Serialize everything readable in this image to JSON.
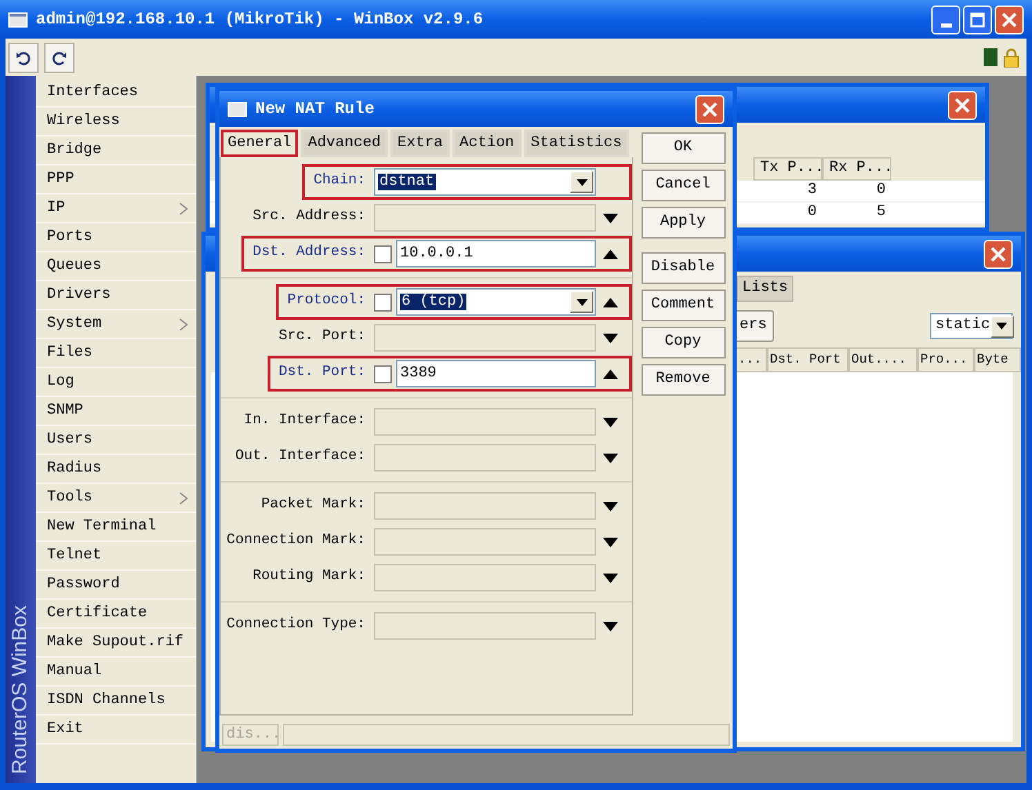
{
  "window": {
    "title": "admin@192.168.10.1 (MikroTik) - WinBox v2.9.6"
  },
  "sidebar": {
    "brand": "RouterOS WinBox",
    "items": [
      {
        "label": "Interfaces",
        "submenu": false
      },
      {
        "label": "Wireless",
        "submenu": false
      },
      {
        "label": "Bridge",
        "submenu": false
      },
      {
        "label": "PPP",
        "submenu": false
      },
      {
        "label": "IP",
        "submenu": true
      },
      {
        "label": "Ports",
        "submenu": false
      },
      {
        "label": "Queues",
        "submenu": false
      },
      {
        "label": "Drivers",
        "submenu": false
      },
      {
        "label": "System",
        "submenu": true
      },
      {
        "label": "Files",
        "submenu": false
      },
      {
        "label": "Log",
        "submenu": false
      },
      {
        "label": "SNMP",
        "submenu": false
      },
      {
        "label": "Users",
        "submenu": false
      },
      {
        "label": "Radius",
        "submenu": false
      },
      {
        "label": "Tools",
        "submenu": true
      },
      {
        "label": "New Terminal",
        "submenu": false
      },
      {
        "label": "Telnet",
        "submenu": false
      },
      {
        "label": "Password",
        "submenu": false
      },
      {
        "label": "Certificate",
        "submenu": false
      },
      {
        "label": "Make Supout.rif",
        "submenu": false
      },
      {
        "label": "Manual",
        "submenu": false
      },
      {
        "label": "ISDN Channels",
        "submenu": false
      },
      {
        "label": "Exit",
        "submenu": false
      }
    ]
  },
  "back_window": {
    "columns": [
      "Tx P...",
      "Rx P..."
    ],
    "rows": [
      [
        "3",
        "0"
      ],
      [
        "0",
        "5"
      ]
    ]
  },
  "firewall_window": {
    "tab": {
      "label": "Lists",
      "selected": false
    },
    "button": "ers",
    "filter": "static",
    "columns": [
      "...",
      "Dst. Port",
      "Out....",
      "Pro...",
      "Byte"
    ]
  },
  "dialog": {
    "title": "New NAT Rule",
    "tabs": [
      {
        "label": "General",
        "selected": true,
        "highlighted": true
      },
      {
        "label": "Advanced",
        "selected": false,
        "highlighted": false
      },
      {
        "label": "Extra",
        "selected": false,
        "highlighted": false
      },
      {
        "label": "Action",
        "selected": false,
        "highlighted": false
      },
      {
        "label": "Statistics",
        "selected": false,
        "highlighted": false
      }
    ],
    "groups": [
      [
        {
          "label": "Chain:",
          "kind": "select",
          "value": "dstnat",
          "value_selected": true,
          "highlighted": true,
          "expanded": true
        },
        {
          "label": "Src. Address:",
          "kind": "text",
          "highlighted": false,
          "expanded": false
        },
        {
          "label": "Dst. Address:",
          "kind": "text",
          "value": "10.0.0.1",
          "value_selected": false,
          "negated": false,
          "highlighted": true,
          "expanded": true
        }
      ],
      [
        {
          "label": "Protocol:",
          "kind": "combo",
          "value": "6 (tcp)",
          "value_selected": true,
          "negated": false,
          "highlighted": true,
          "expanded": true
        },
        {
          "label": "Src. Port:",
          "kind": "text",
          "highlighted": false,
          "expanded": false
        },
        {
          "label": "Dst. Port:",
          "kind": "text",
          "value": "3389",
          "value_selected": false,
          "negated": false,
          "highlighted": true,
          "expanded": true
        }
      ],
      [
        {
          "label": "In. Interface:",
          "kind": "text",
          "highlighted": false,
          "expanded": false
        },
        {
          "label": "Out. Interface:",
          "kind": "text",
          "highlighted": false,
          "expanded": false
        }
      ],
      [
        {
          "label": "Packet Mark:",
          "kind": "text",
          "highlighted": false,
          "expanded": false
        },
        {
          "label": "Connection Mark:",
          "kind": "text",
          "highlighted": false,
          "expanded": false
        },
        {
          "label": "Routing Mark:",
          "kind": "text",
          "highlighted": false,
          "expanded": false
        }
      ],
      [
        {
          "label": "Connection Type:",
          "kind": "text",
          "highlighted": false,
          "expanded": false
        }
      ]
    ],
    "button_groups": [
      [
        "OK",
        "Cancel",
        "Apply"
      ],
      [
        "Disable",
        "Comment",
        "Copy",
        "Remove"
      ]
    ],
    "status": "dis..."
  }
}
